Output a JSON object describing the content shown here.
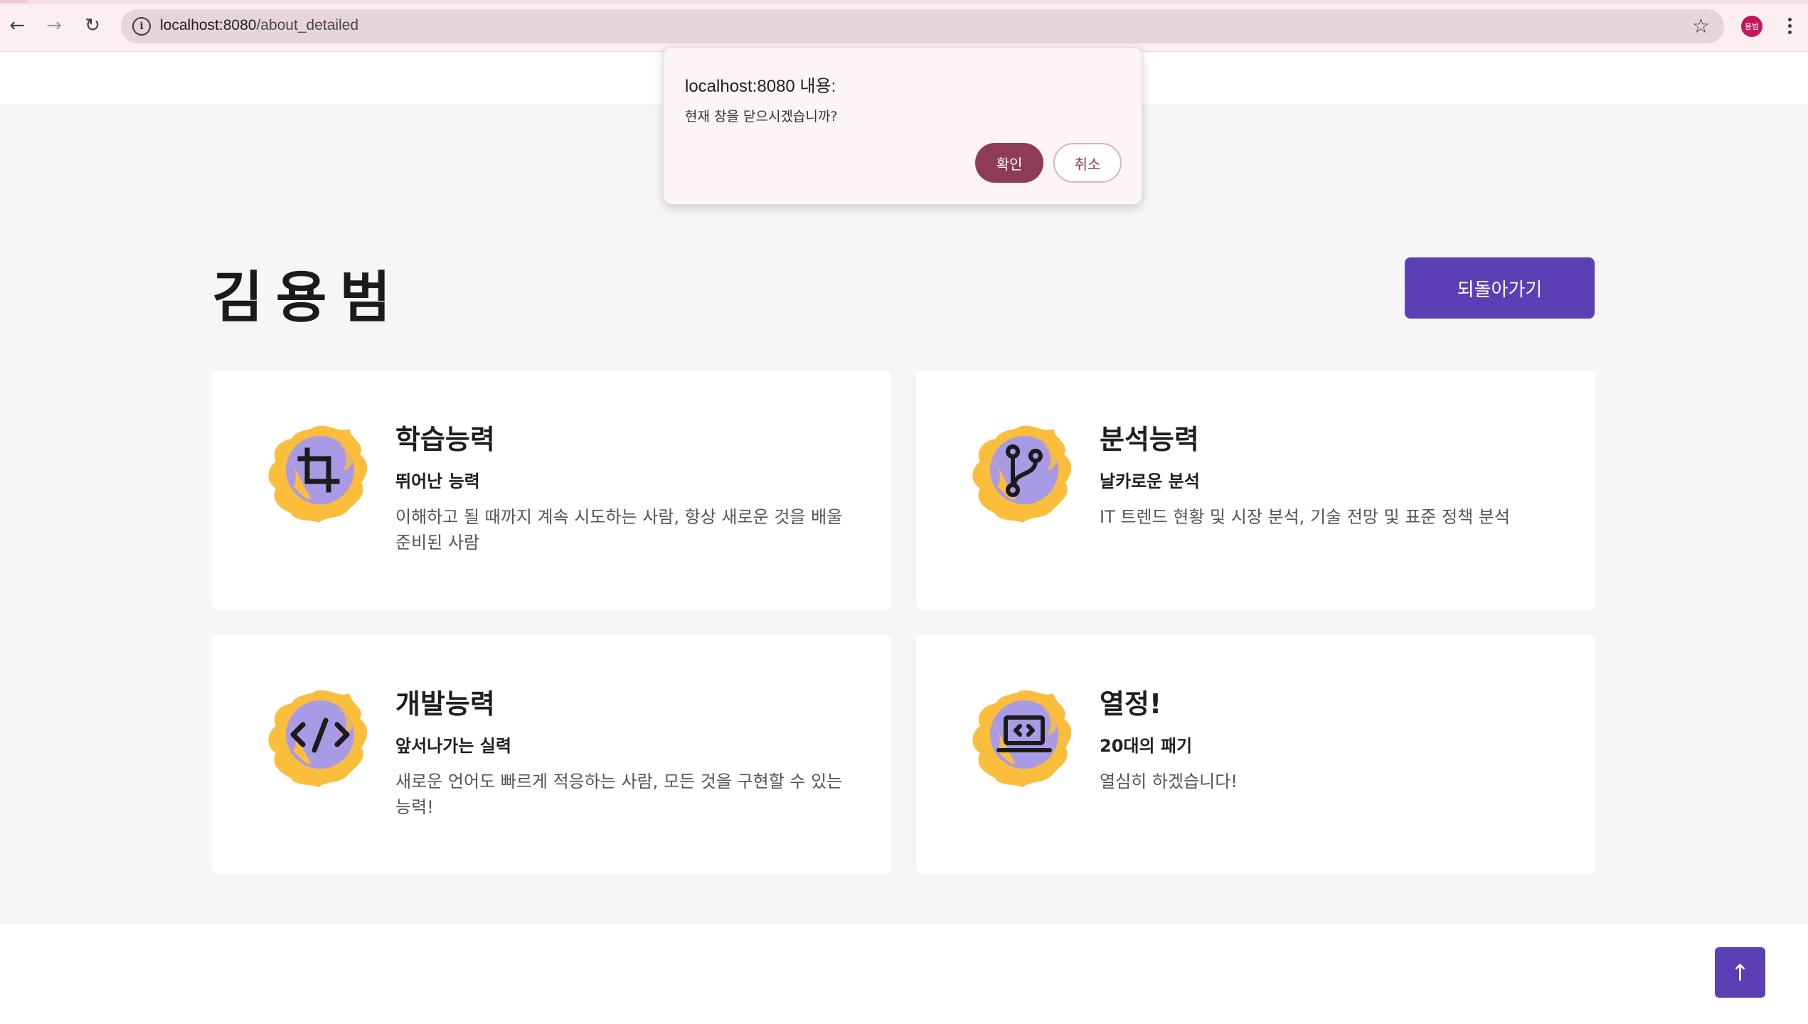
{
  "browser": {
    "url_host": "localhost:8080",
    "url_path": "/about_detailed",
    "back_icon": "←",
    "forward_icon": "→",
    "reload_icon": "↻",
    "info_icon": "i",
    "star_icon": "☆",
    "profile_initials": "용범"
  },
  "page": {
    "title": "김용범",
    "back_button_label": "되돌아가기",
    "scroll_top_icon": "↑"
  },
  "cards": [
    {
      "title": "학습능력",
      "subtitle": "뛰어난 능력",
      "description": "이해하고 될 때까지 계속 시도하는 사람, 항상 새로운 것을 배울 준비된 사람",
      "icon": "crop-icon"
    },
    {
      "title": "분석능력",
      "subtitle": "날카로운 분석",
      "description": "IT 트렌드 현황 및 시장 분석, 기술 전망 및 표준 정책 분석",
      "icon": "git-branch-icon"
    },
    {
      "title": "개발능력",
      "subtitle": "앞서나가는 실력",
      "description": "새로운 언어도 빠르게 적응하는 사람, 모든 것을 구현할 수 있는 능력!",
      "icon": "code-icon"
    },
    {
      "title": "열정!",
      "subtitle": "20대의 패기",
      "description": "열심히 하겠습니다!",
      "icon": "laptop-code-icon"
    }
  ],
  "dialog": {
    "title": "localhost:8080 내용:",
    "message": "현재 창을 닫으시겠습니까?",
    "ok_label": "확인",
    "cancel_label": "취소"
  },
  "colors": {
    "accent": "#5a3fb5",
    "dialog_ok": "#8e3b55",
    "splash_yellow": "#fbbd3c",
    "splash_purple": "#a99ae6"
  }
}
